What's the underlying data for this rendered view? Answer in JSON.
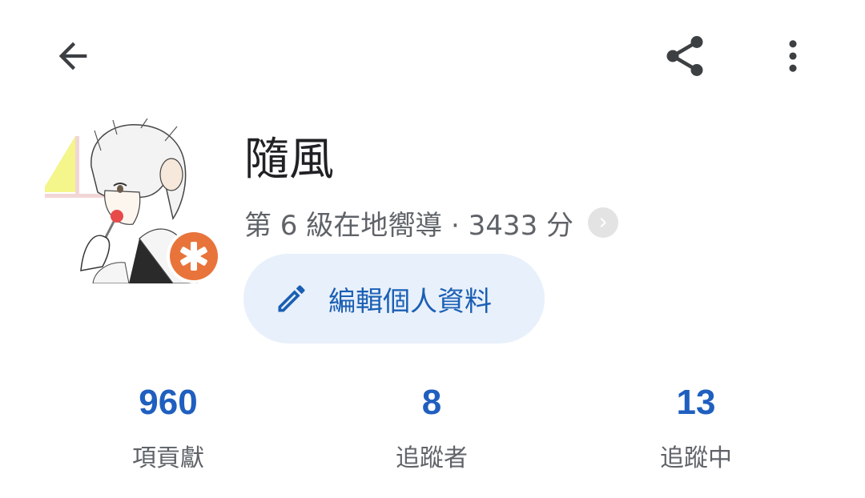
{
  "toolbar": {
    "back_icon": "arrow-back-icon",
    "share_icon": "share-icon",
    "more_icon": "more-vert-icon"
  },
  "profile": {
    "name": "隨風",
    "level_text": "第 6 級在地嚮導 · 3433 分",
    "edit_label": "編輯個人資料",
    "badge_color": "#e8743b",
    "accent_color": "#1f5fbf"
  },
  "stats": [
    {
      "value": "960",
      "label": "項貢獻"
    },
    {
      "value": "8",
      "label": "追蹤者"
    },
    {
      "value": "13",
      "label": "追蹤中"
    }
  ]
}
